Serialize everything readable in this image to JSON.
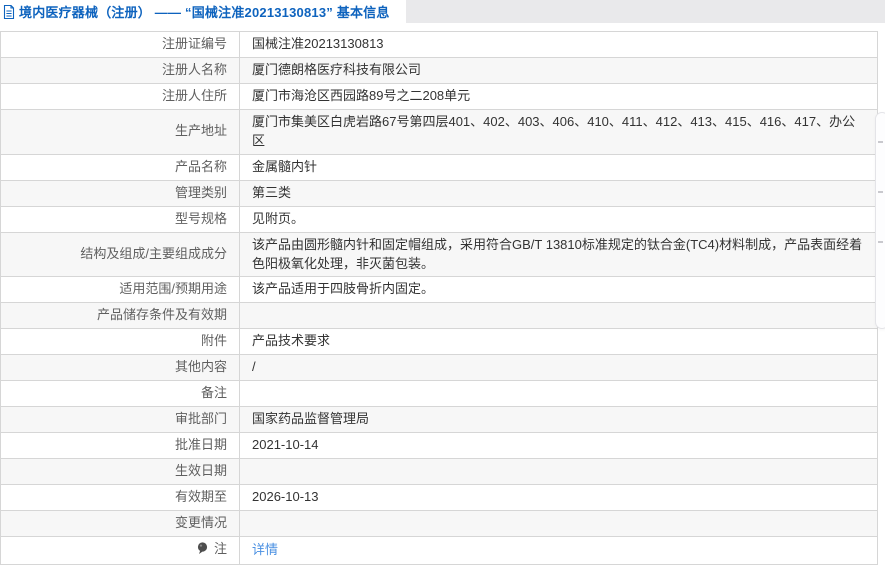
{
  "header": {
    "title": "境内医疗器械（注册） —— “国械注准20213130813” 基本信息"
  },
  "table": {
    "rows": [
      {
        "label": "注册证编号",
        "value": "国械注准20213130813"
      },
      {
        "label": "注册人名称",
        "value": "厦门德朗格医疗科技有限公司"
      },
      {
        "label": "注册人住所",
        "value": "厦门市海沧区西园路89号之二208单元"
      },
      {
        "label": "生产地址",
        "value": "厦门市集美区白虎岩路67号第四层401、402、403、406、410、411、412、413、415、416、417、办公区"
      },
      {
        "label": "产品名称",
        "value": "金属髓内针"
      },
      {
        "label": "管理类别",
        "value": "第三类"
      },
      {
        "label": "型号规格",
        "value": "见附页。"
      },
      {
        "label": "结构及组成/主要组成成分",
        "value": "该产品由圆形髓内针和固定帽组成，采用符合GB/T 13810标准规定的钛合金(TC4)材料制成，产品表面经着色阳极氧化处理，非灭菌包装。"
      },
      {
        "label": "适用范围/预期用途",
        "value": "该产品适用于四肢骨折内固定。"
      },
      {
        "label": "产品储存条件及有效期",
        "value": ""
      },
      {
        "label": "附件",
        "value": "产品技术要求"
      },
      {
        "label": "其他内容",
        "value": "/"
      },
      {
        "label": "备注",
        "value": ""
      },
      {
        "label": "审批部门",
        "value": "国家药品监督管理局"
      },
      {
        "label": "批准日期",
        "value": "2021-10-14"
      },
      {
        "label": "生效日期",
        "value": ""
      },
      {
        "label": "有效期至",
        "value": "2026-10-13"
      },
      {
        "label": "变更情况",
        "value": ""
      },
      {
        "label": "注",
        "value": "详情",
        "link": true,
        "icon": "pin"
      }
    ]
  },
  "colors": {
    "accent": "#0e63be",
    "link": "#4a90e2",
    "stripe": "#f7f7f7",
    "table_border": "#d6d6d6",
    "tabbar_bg": "#e9e9eb",
    "label_color": "#5f5f5f",
    "value_color": "#333333"
  }
}
